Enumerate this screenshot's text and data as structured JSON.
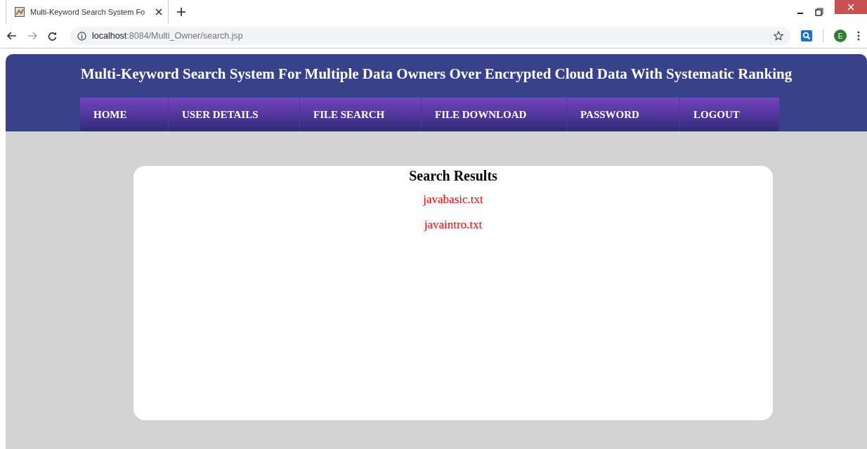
{
  "browser": {
    "tab_title": "Multi-Keyword Search System Fo",
    "url_host": "localhost",
    "url_path": ":8084/Multi_Owner/search.jsp",
    "profile_initial": "E"
  },
  "header": {
    "title": "Multi-Keyword Search System For Multiple Data Owners Over Encrypted Cloud Data With Systematic Ranking"
  },
  "nav": [
    {
      "label": "HOME"
    },
    {
      "label": "USER DETAILS"
    },
    {
      "label": "FILE SEARCH"
    },
    {
      "label": "FILE DOWNLOAD"
    },
    {
      "label": "PASSWORD"
    },
    {
      "label": "LOGOUT"
    }
  ],
  "results": {
    "heading": "Search Results",
    "files": [
      "javabasic.txt",
      "javaintro.txt"
    ]
  }
}
